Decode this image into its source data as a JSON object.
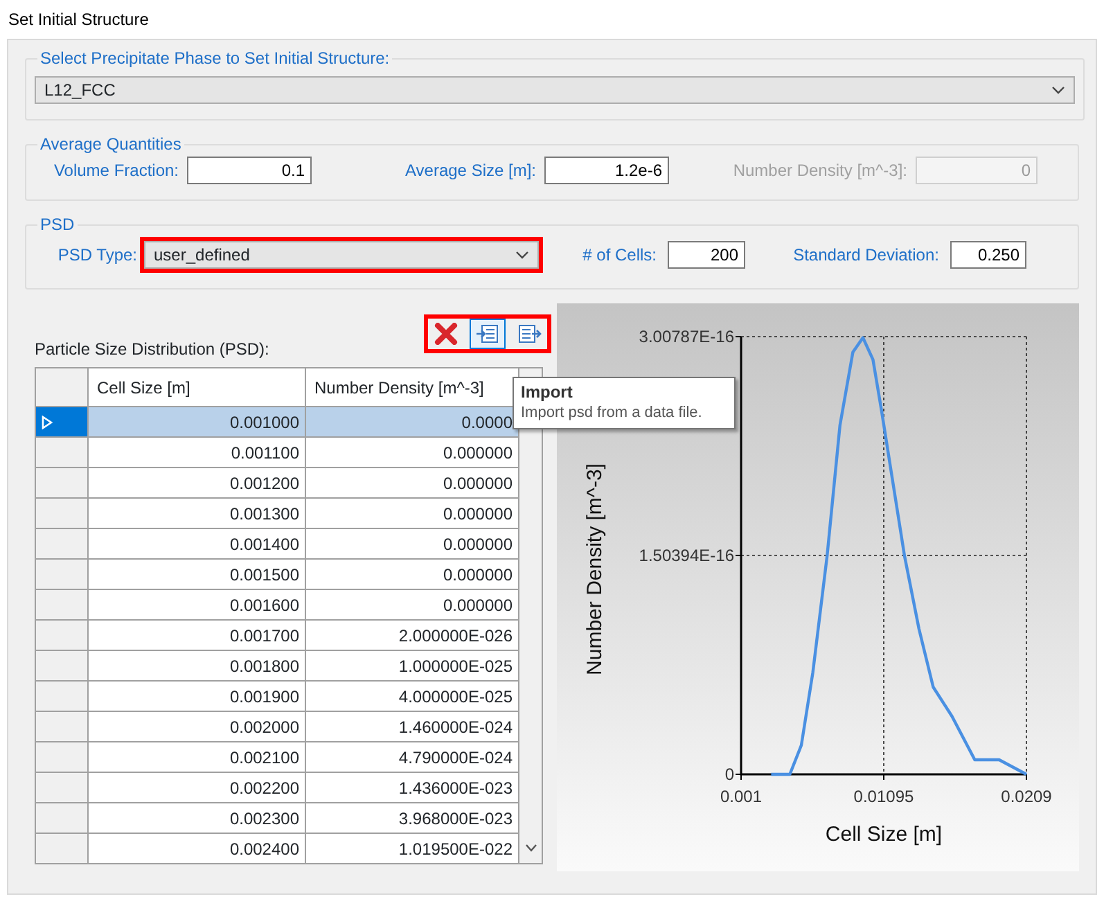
{
  "window": {
    "title": "Set Initial Structure"
  },
  "phase_group": {
    "legend": "Select Precipitate Phase to Set Initial Structure:",
    "phase": {
      "value": "L12_FCC"
    }
  },
  "average_quantities": {
    "legend": "Average Quantities",
    "fields": [
      {
        "label": "Volume Fraction:",
        "value": "0.1",
        "disabled": false
      },
      {
        "label": "Average Size [m]:",
        "value": "1.2e-6",
        "disabled": false
      },
      {
        "label": "Number Density [m^-3]:",
        "value": "0",
        "disabled": true
      }
    ]
  },
  "psd": {
    "legend": "PSD",
    "type": {
      "label": "PSD Type:",
      "value": "user_defined",
      "highlighted": true
    },
    "fields": [
      {
        "label": "# of Cells:",
        "value": "200"
      },
      {
        "label": "Standard Deviation:",
        "value": "0.250"
      }
    ]
  },
  "psd_table": {
    "label": "Particle Size Distribution (PSD):",
    "toolbar": {
      "highlighted": true,
      "buttons": [
        {
          "kind": "delete",
          "hovered": false
        },
        {
          "kind": "import",
          "hovered": true
        },
        {
          "kind": "export",
          "hovered": false
        }
      ]
    },
    "columns": [
      "Cell Size [m]",
      "Number Density [m^-3]"
    ],
    "rows": [
      {
        "selected": true,
        "cells": [
          "0.001000",
          "0.0000"
        ]
      },
      {
        "selected": false,
        "cells": [
          "0.001100",
          "0.000000"
        ]
      },
      {
        "selected": false,
        "cells": [
          "0.001200",
          "0.000000"
        ]
      },
      {
        "selected": false,
        "cells": [
          "0.001300",
          "0.000000"
        ]
      },
      {
        "selected": false,
        "cells": [
          "0.001400",
          "0.000000"
        ]
      },
      {
        "selected": false,
        "cells": [
          "0.001500",
          "0.000000"
        ]
      },
      {
        "selected": false,
        "cells": [
          "0.001600",
          "0.000000"
        ]
      },
      {
        "selected": false,
        "cells": [
          "0.001700",
          "2.000000E-026"
        ]
      },
      {
        "selected": false,
        "cells": [
          "0.001800",
          "1.000000E-025"
        ]
      },
      {
        "selected": false,
        "cells": [
          "0.001900",
          "4.000000E-025"
        ]
      },
      {
        "selected": false,
        "cells": [
          "0.002000",
          "1.460000E-024"
        ]
      },
      {
        "selected": false,
        "cells": [
          "0.002100",
          "4.790000E-024"
        ]
      },
      {
        "selected": false,
        "cells": [
          "0.002200",
          "1.436000E-023"
        ]
      },
      {
        "selected": false,
        "cells": [
          "0.002300",
          "3.968000E-023"
        ]
      },
      {
        "selected": false,
        "cells": [
          "0.002400",
          "1.019500E-022"
        ]
      }
    ]
  },
  "tooltip": {
    "title": "Import",
    "text": "Import psd from a data file."
  },
  "chart": {
    "chart_data": {
      "type": "line",
      "xlabel": "Cell Size [m]",
      "ylabel": "Number Density [m^-3]",
      "x": [
        0.0031,
        0.0044,
        0.0052,
        0.006,
        0.007,
        0.0079,
        0.0088,
        0.0095,
        0.0102,
        0.0108,
        0.0116,
        0.0124,
        0.0134,
        0.0144,
        0.0157,
        0.0173,
        0.019,
        0.0209
      ],
      "series": [
        {
          "color": "#4a90e2",
          "values": [
            0,
            0,
            2e-17,
            7e-17,
            1.5e-16,
            2.4e-16,
            2.9e-16,
            3e-16,
            2.85e-16,
            2.5e-16,
            2e-16,
            1.5e-16,
            1e-16,
            6e-17,
            4e-17,
            1e-17,
            1e-17,
            0
          ]
        }
      ],
      "xlim": [
        0.001,
        0.0209
      ],
      "ylim": [
        0,
        3.00787e-16
      ],
      "xticks": [
        0.001,
        0.01095,
        0.0209
      ],
      "yticks": [
        {
          "value": 0,
          "label": "0"
        },
        {
          "value": 1.50394e-16,
          "label": "1.50394E-16"
        },
        {
          "value": 3.00787e-16,
          "label": "3.00787E-16"
        }
      ]
    }
  }
}
